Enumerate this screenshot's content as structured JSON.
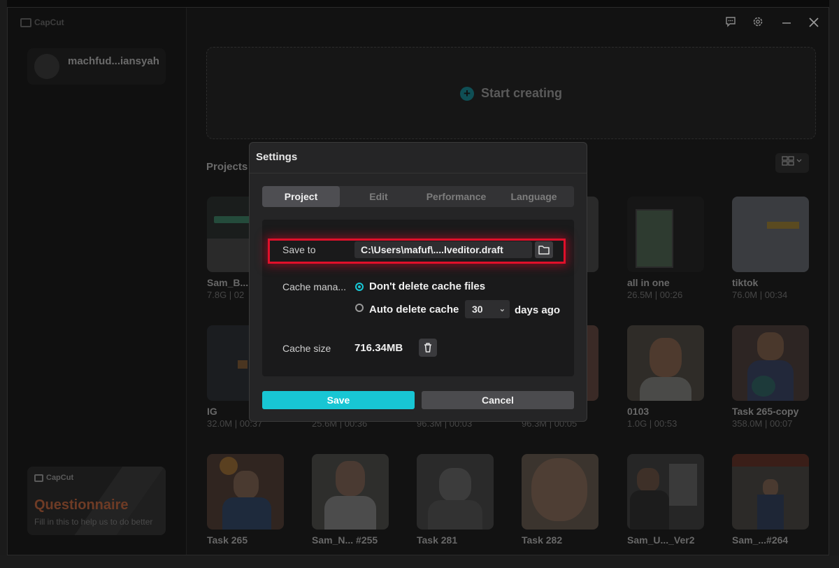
{
  "app": {
    "logo_text": "CapCut",
    "user_name": "machfud...iansyah",
    "start_label": "Start creating",
    "projects_title": "Projects"
  },
  "questionnaire": {
    "logo_text": "CapCut",
    "title": "Questionnaire",
    "subtitle": "Fill in this to help us to do better"
  },
  "projects": [
    {
      "name": "Sam_B...",
      "meta": "7.8G | 02"
    },
    {
      "name": "all in one",
      "meta": "26.5M | 00:26"
    },
    {
      "name": "tiktok",
      "meta": "76.0M | 00:34"
    },
    {
      "name": "IG",
      "meta": "32.0M | 00:37"
    },
    {
      "name": "",
      "meta": "25.6M | 00:36"
    },
    {
      "name": "",
      "meta": "96.3M | 00:03"
    },
    {
      "name": "",
      "meta": "96.3M | 00:05"
    },
    {
      "name": "0103",
      "meta": "1.0G | 00:53"
    },
    {
      "name": "Task 265-copy",
      "meta": "358.0M | 00:07"
    },
    {
      "name": "Task 265",
      "meta": ""
    },
    {
      "name": "Sam_N... #255",
      "meta": ""
    },
    {
      "name": "Task 281",
      "meta": ""
    },
    {
      "name": "Task 282",
      "meta": ""
    },
    {
      "name": "Sam_U..._Ver2",
      "meta": ""
    },
    {
      "name": "Sam_...#264",
      "meta": ""
    }
  ],
  "settings": {
    "title": "Settings",
    "tabs": [
      "Project",
      "Edit",
      "Performance",
      "Language"
    ],
    "active_tab": "Project",
    "save_to_label": "Save to",
    "save_to_path": "C:\\Users\\mafuf\\....lveditor.draft",
    "cache_label": "Cache mana...",
    "cache_option_1": "Don't delete cache files",
    "cache_option_2": "Auto delete cache",
    "cache_selected": "option_1",
    "days_value": "30",
    "days_suffix": "days ago",
    "cache_size_label": "Cache size",
    "cache_size_value": "716.34MB",
    "save_button": "Save",
    "cancel_button": "Cancel"
  },
  "colors": {
    "accent": "#18c6d4",
    "highlight": "#e0102a",
    "modal_bg": "#252526",
    "app_bg": "#121212"
  }
}
